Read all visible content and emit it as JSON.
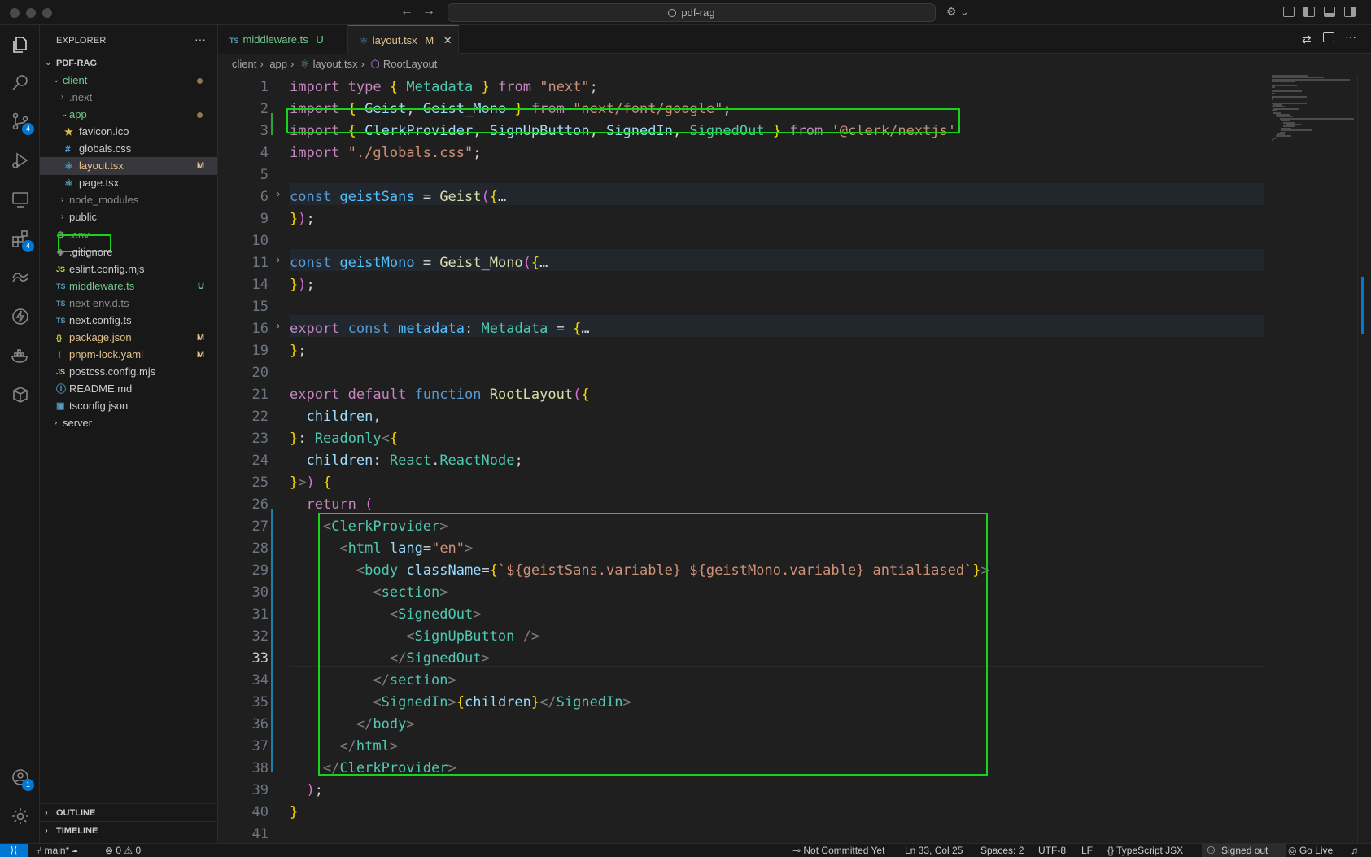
{
  "window": {
    "search_text": "pdf-rag"
  },
  "activity_bar": {
    "source_control_badge": "4",
    "extensions_badge": "4",
    "accounts_badge": "1"
  },
  "explorer": {
    "title": "EXPLORER",
    "project": "PDF-RAG",
    "items": [
      {
        "label": "client",
        "icon": "chevron-down",
        "status": ""
      },
      {
        "label": ".next",
        "icon": "chevron-right",
        "status": ""
      },
      {
        "label": "app",
        "icon": "chevron-down",
        "status": ""
      },
      {
        "label": "favicon.ico",
        "icon": "star-icon",
        "status": ""
      },
      {
        "label": "globals.css",
        "icon": "hash-icon",
        "status": ""
      },
      {
        "label": "layout.tsx",
        "icon": "react-icon",
        "status": "M"
      },
      {
        "label": "page.tsx",
        "icon": "react-icon",
        "status": ""
      },
      {
        "label": "node_modules",
        "icon": "chevron-right",
        "status": ""
      },
      {
        "label": "public",
        "icon": "chevron-right",
        "status": ""
      },
      {
        "label": ".env",
        "icon": "gear-icon",
        "status": ""
      },
      {
        "label": ".gitignore",
        "icon": "git-icon",
        "status": ""
      },
      {
        "label": "eslint.config.mjs",
        "icon": "js-icon",
        "status": ""
      },
      {
        "label": "middleware.ts",
        "icon": "ts-icon",
        "status": "U"
      },
      {
        "label": "next-env.d.ts",
        "icon": "ts-icon",
        "status": ""
      },
      {
        "label": "next.config.ts",
        "icon": "ts-icon",
        "status": ""
      },
      {
        "label": "package.json",
        "icon": "braces-icon",
        "status": "M"
      },
      {
        "label": "pnpm-lock.yaml",
        "icon": "exclamation-icon",
        "status": "M"
      },
      {
        "label": "postcss.config.mjs",
        "icon": "js-icon",
        "status": ""
      },
      {
        "label": "README.md",
        "icon": "info-icon",
        "status": ""
      },
      {
        "label": "tsconfig.json",
        "icon": "tsconfig-icon",
        "status": ""
      },
      {
        "label": "server",
        "icon": "chevron-right",
        "status": ""
      }
    ],
    "outline": "OUTLINE",
    "timeline": "TIMELINE"
  },
  "tabs": [
    {
      "prefix": "TS",
      "label": "middleware.ts",
      "status": "U"
    },
    {
      "prefix": "",
      "label": "layout.tsx",
      "status": "M"
    }
  ],
  "breadcrumb": [
    "client",
    "app",
    "layout.tsx",
    "RootLayout"
  ],
  "code": {
    "lines": [
      {
        "n": "1",
        "text": "import type { Metadata } from \"next\";"
      },
      {
        "n": "2",
        "text": "import { Geist, Geist_Mono } from \"next/font/google\";"
      },
      {
        "n": "3",
        "text": "import { ClerkProvider, SignUpButton, SignedIn, SignedOut } from '@clerk/nextjs'"
      },
      {
        "n": "4",
        "text": "import \"./globals.css\";"
      },
      {
        "n": "5",
        "text": ""
      },
      {
        "n": "6",
        "text": "const geistSans = Geist({…"
      },
      {
        "n": "9",
        "text": "});"
      },
      {
        "n": "10",
        "text": ""
      },
      {
        "n": "11",
        "text": "const geistMono = Geist_Mono({…"
      },
      {
        "n": "14",
        "text": "});"
      },
      {
        "n": "15",
        "text": ""
      },
      {
        "n": "16",
        "text": "export const metadata: Metadata = {…"
      },
      {
        "n": "19",
        "text": "};"
      },
      {
        "n": "20",
        "text": ""
      },
      {
        "n": "21",
        "text": "export default function RootLayout({"
      },
      {
        "n": "22",
        "text": "  children,"
      },
      {
        "n": "23",
        "text": "}: Readonly<{"
      },
      {
        "n": "24",
        "text": "  children: React.ReactNode;"
      },
      {
        "n": "25",
        "text": "}>) {"
      },
      {
        "n": "26",
        "text": "  return ("
      },
      {
        "n": "27",
        "text": "    <ClerkProvider>"
      },
      {
        "n": "28",
        "text": "      <html lang=\"en\">"
      },
      {
        "n": "29",
        "text": "        <body className={`${geistSans.variable} ${geistMono.variable} antialiased`}>"
      },
      {
        "n": "30",
        "text": "          <section>"
      },
      {
        "n": "31",
        "text": "            <SignedOut>"
      },
      {
        "n": "32",
        "text": "              <SignUpButton />"
      },
      {
        "n": "33",
        "text": "            </SignedOut>"
      },
      {
        "n": "34",
        "text": "          </section>"
      },
      {
        "n": "35",
        "text": "          <SignedIn>{children}</SignedIn>"
      },
      {
        "n": "36",
        "text": "        </body>"
      },
      {
        "n": "37",
        "text": "      </html>"
      },
      {
        "n": "38",
        "text": "    </ClerkProvider>"
      },
      {
        "n": "39",
        "text": "  );"
      },
      {
        "n": "40",
        "text": "}"
      },
      {
        "n": "41",
        "text": ""
      }
    ]
  },
  "status_bar": {
    "branch": "main*",
    "errors": "0",
    "warnings": "0",
    "commit": "Not Committed Yet",
    "position": "Ln 33, Col 25",
    "spaces": "Spaces: 2",
    "encoding": "UTF-8",
    "eol": "LF",
    "language": "TypeScript JSX",
    "account": "Signed out",
    "live": "Go Live"
  },
  "colors": {
    "highlight_box": "#19d21a",
    "accent": "#0078d4"
  }
}
